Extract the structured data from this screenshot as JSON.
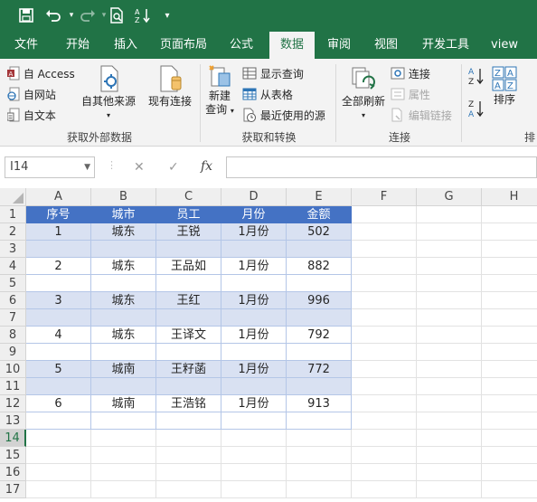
{
  "qat": {
    "save_icon": "save-icon",
    "undo_icon": "undo-icon",
    "redo_icon": "redo-icon",
    "preview_icon": "print-preview-icon",
    "sort_icon": "sort-icon",
    "customize_icon": "customize-icon"
  },
  "tabs": [
    {
      "label": "文件"
    },
    {
      "label": "开始"
    },
    {
      "label": "插入"
    },
    {
      "label": "页面布局"
    },
    {
      "label": "公式"
    },
    {
      "label": "数据"
    },
    {
      "label": "审阅"
    },
    {
      "label": "视图"
    },
    {
      "label": "开发工具"
    },
    {
      "label": "view"
    }
  ],
  "ribbon": {
    "external": {
      "access": "自 Access",
      "web": "自网站",
      "text": "自文本",
      "other": "自其他来源",
      "existing": "现有连接",
      "group": "获取外部数据"
    },
    "transform": {
      "new_query": "新建\n查询",
      "new_query_line1": "新建",
      "new_query_line2": "查询",
      "show_queries": "显示查询",
      "from_table": "从表格",
      "recent_sources": "最近使用的源",
      "group": "获取和转换"
    },
    "connections": {
      "refresh_all": "全部刷新",
      "connections": "连接",
      "properties": "属性",
      "edit_links": "编辑链接",
      "group": "连接"
    },
    "sort": {
      "sort": "排序",
      "group_partial": "排"
    }
  },
  "formula_bar": {
    "name_box": "I14",
    "fx": "fx",
    "cancel": "✕",
    "enter": "✓",
    "formula": ""
  },
  "columns": [
    "A",
    "B",
    "C",
    "D",
    "E",
    "F",
    "G",
    "H"
  ],
  "rows": [
    "1",
    "2",
    "3",
    "4",
    "5",
    "6",
    "7",
    "8",
    "9",
    "10",
    "11",
    "12",
    "13",
    "14",
    "15",
    "16",
    "17"
  ],
  "selected_row": "14",
  "table": {
    "headers": [
      "序号",
      "城市",
      "员工",
      "月份",
      "金额"
    ],
    "rows": [
      [
        "1",
        "城东",
        "王锐",
        "1月份",
        "502"
      ],
      [
        "",
        "",
        "",
        "",
        ""
      ],
      [
        "2",
        "城东",
        "王品如",
        "1月份",
        "882"
      ],
      [
        "",
        "",
        "",
        "",
        ""
      ],
      [
        "3",
        "城东",
        "王红",
        "1月份",
        "996"
      ],
      [
        "",
        "",
        "",
        "",
        ""
      ],
      [
        "4",
        "城东",
        "王译文",
        "1月份",
        "792"
      ],
      [
        "",
        "",
        "",
        "",
        ""
      ],
      [
        "5",
        "城南",
        "王籽菡",
        "1月份",
        "772"
      ],
      [
        "",
        "",
        "",
        "",
        ""
      ],
      [
        "6",
        "城南",
        "王浩铭",
        "1月份",
        "913"
      ],
      [
        "",
        "",
        "",
        "",
        ""
      ]
    ]
  },
  "colors": {
    "excel_green": "#217346",
    "table_header": "#4472c4",
    "band": "#d9e1f2"
  }
}
